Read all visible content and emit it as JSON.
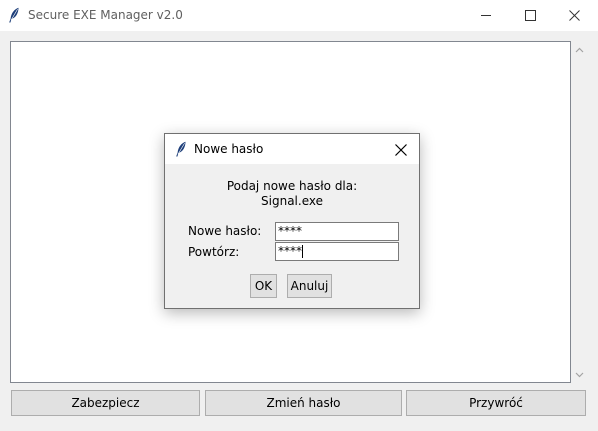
{
  "main_window": {
    "title": "Secure EXE Manager v2.0",
    "icons": {
      "app": "feather-icon",
      "minimize": "minimize-icon",
      "maximize": "maximize-icon",
      "close": "close-icon"
    },
    "buttons": {
      "secure": "Zabezpiecz",
      "change_password": "Zmień hasło",
      "restore": "Przywróć"
    }
  },
  "dialog": {
    "title": "Nowe hasło",
    "prompt_line1": "Podaj nowe hasło dla:",
    "prompt_line2": "Signal.exe",
    "new_password_label": "Nowe hasło:",
    "new_password_value": "****",
    "repeat_label": "Powtórz:",
    "repeat_value": "****",
    "ok_label": "OK",
    "cancel_label": "Anuluj"
  }
}
